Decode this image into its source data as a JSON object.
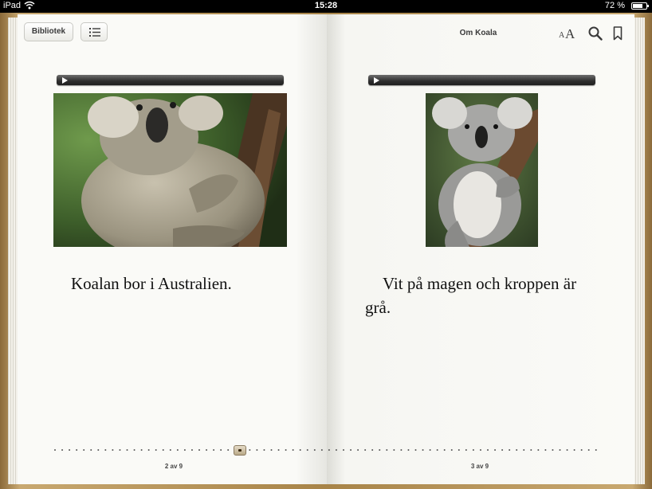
{
  "status_bar": {
    "carrier": "iPad",
    "time": "15:28",
    "battery": "72 %",
    "battery_level": 0.72
  },
  "toolbar": {
    "library_label": "Bibliotek",
    "book_title": "Om Koala",
    "font_icon_small": "A",
    "font_icon_large": "A",
    "icons": [
      "list-icon",
      "font-size-icon",
      "search-icon",
      "bookmark-icon"
    ]
  },
  "left_page": {
    "audio_icon": "play-icon",
    "photo": "koala-on-tree-branch-photo",
    "text": "Koalan bor i Australien.",
    "page_number": "2 av 9"
  },
  "right_page": {
    "audio_icon": "play-icon",
    "photo": "grey-koala-on-tree-photo",
    "text": "Vit på magen och kroppen är grå.",
    "page_number": "3 av 9"
  },
  "scrubber": {
    "current_position": 0.34
  },
  "colors": {
    "page": "#fafaf7",
    "book_cover": "#a88448",
    "audio_bar": "#2e2e2e",
    "text": "#111111"
  }
}
